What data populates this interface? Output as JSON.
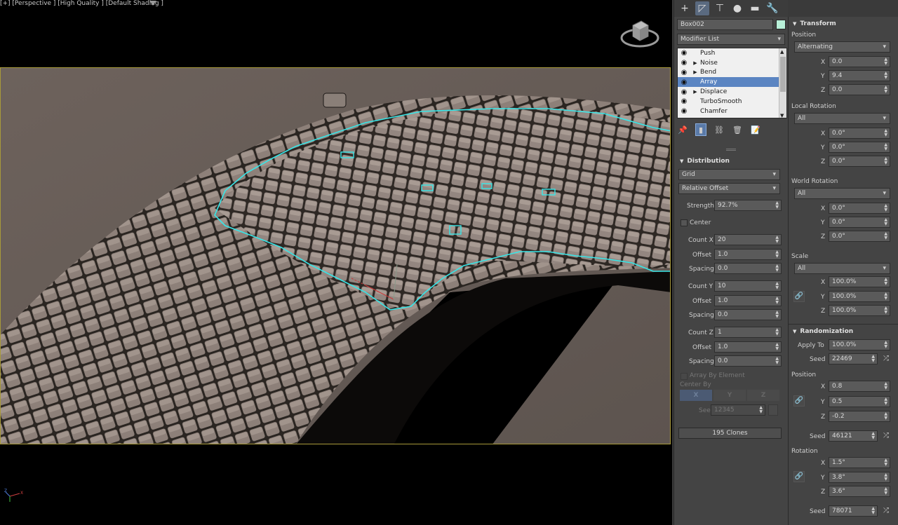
{
  "viewport": {
    "label": "[+] [Perspective ] [High Quality ] [Default Shading ]"
  },
  "command_panel": {
    "tabs": [
      {
        "icon": "create-icon",
        "glyph": "+"
      },
      {
        "icon": "modify-icon",
        "glyph": "◸"
      },
      {
        "icon": "hierarchy-icon",
        "glyph": "⊤"
      },
      {
        "icon": "motion-icon",
        "glyph": "●"
      },
      {
        "icon": "display-icon",
        "glyph": "▬"
      },
      {
        "icon": "utilities-icon",
        "glyph": "🔧"
      }
    ],
    "object_name": "Box002",
    "object_color": "#b8f0d8",
    "modifier_list": "Modifier List",
    "stack": [
      {
        "name": "Push",
        "expandable": false,
        "selected": false
      },
      {
        "name": "Noise",
        "expandable": true,
        "selected": false
      },
      {
        "name": "Bend",
        "expandable": true,
        "selected": false
      },
      {
        "name": "Array",
        "expandable": false,
        "selected": true
      },
      {
        "name": "Displace",
        "expandable": true,
        "selected": false
      },
      {
        "name": "TurboSmooth",
        "expandable": false,
        "selected": false
      },
      {
        "name": "Chamfer",
        "expandable": false,
        "selected": false
      }
    ]
  },
  "distribution": {
    "title": "Distribution",
    "mode": "Grid",
    "offset_mode": "Relative Offset",
    "strength_label": "Strength",
    "strength": "92.7%",
    "center_label": "Center",
    "count_x_label": "Count X",
    "count_x": "20",
    "offset_x_label": "Offset",
    "offset_x": "1.0",
    "spacing_x_label": "Spacing",
    "spacing_x": "0.0",
    "count_y_label": "Count Y",
    "count_y": "10",
    "offset_y_label": "Offset",
    "offset_y": "1.0",
    "spacing_y_label": "Spacing",
    "spacing_y": "0.0",
    "count_z_label": "Count Z",
    "count_z": "1",
    "offset_z_label": "Offset",
    "offset_z": "1.0",
    "spacing_z_label": "Spacing",
    "spacing_z": "0.0",
    "array_by_element_label": "Array By Element",
    "center_by_label": "Center By",
    "axis_buttons": [
      "X",
      "Y",
      "Z"
    ],
    "seed_label": "Seed",
    "seed": "12345",
    "clones": "195 Clones"
  },
  "transform": {
    "title": "Transform",
    "position_label": "Position",
    "position_mode": "Alternating",
    "pos_x": "0.0",
    "pos_y": "9.4",
    "pos_z": "0.0",
    "local_rotation_label": "Local Rotation",
    "local_rotation_mode": "All",
    "lrot_x": "0.0°",
    "lrot_y": "0.0°",
    "lrot_z": "0.0°",
    "world_rotation_label": "World Rotation",
    "world_rotation_mode": "All",
    "wrot_x": "0.0°",
    "wrot_y": "0.0°",
    "wrot_z": "0.0°",
    "scale_label": "Scale",
    "scale_mode": "All",
    "scale_x": "100.0%",
    "scale_y": "100.0%",
    "scale_z": "100.0%"
  },
  "randomization": {
    "title": "Randomization",
    "apply_to_label": "Apply To",
    "apply_to": "100.0%",
    "seed_label": "Seed",
    "seed": "22469",
    "position_label": "Position",
    "pos_x": "0.8",
    "pos_y": "0.5",
    "pos_z": "-0.2",
    "pos_seed": "46121",
    "rotation_label": "Rotation",
    "rot_x": "1.5°",
    "rot_y": "3.8°",
    "rot_z": "3.6°",
    "rot_seed": "78071"
  },
  "axis_letters": {
    "x": "X",
    "y": "Y",
    "z": "Z"
  }
}
